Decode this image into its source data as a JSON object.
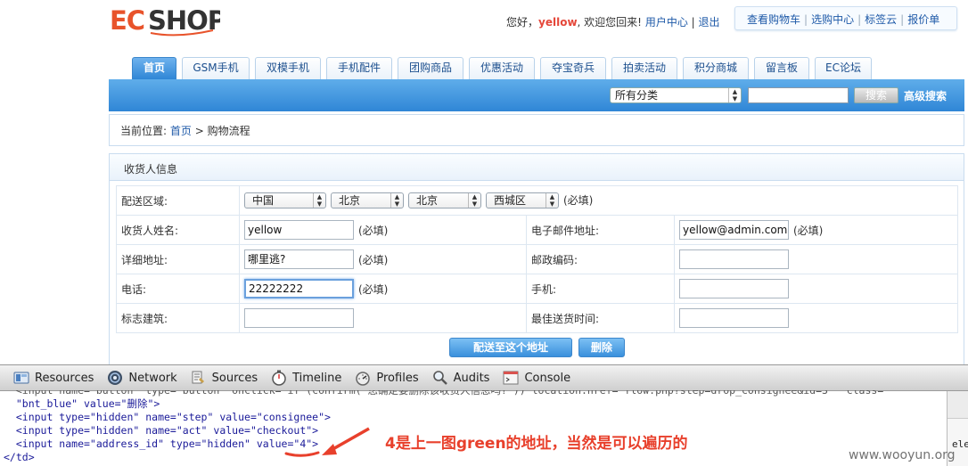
{
  "header": {
    "greeting": "您好，",
    "username": "yellow",
    "welcome": ", 欢迎您回来!",
    "user_center": "用户中心",
    "logout": "退出",
    "sep": "|",
    "top_links": [
      "查看购物车",
      "选购中心",
      "标签云",
      "报价单"
    ]
  },
  "nav": {
    "tabs": [
      "首页",
      "GSM手机",
      "双模手机",
      "手机配件",
      "团购商品",
      "优惠活动",
      "夺宝奇兵",
      "拍卖活动",
      "积分商城",
      "留言板",
      "EC论坛"
    ],
    "active_index": 0
  },
  "search": {
    "category": "所有分类",
    "query": "",
    "button": "搜索",
    "advanced": "高级搜索"
  },
  "breadcrumb": {
    "prefix": "当前位置: ",
    "home": "首页",
    "sep": " > ",
    "current": "购物流程"
  },
  "consignee": {
    "title": "收货人信息",
    "region_label": "配送区域:",
    "regions": [
      "中国",
      "北京",
      "北京",
      "西城区"
    ],
    "required": "(必填)",
    "name_label": "收货人姓名:",
    "name_value": "yellow",
    "email_label": "电子邮件地址:",
    "email_value": "yellow@admin.com",
    "address_label": "详细地址:",
    "address_value": "哪里逃?",
    "zipcode_label": "邮政编码:",
    "zipcode_value": "",
    "phone_label": "电话:",
    "phone_value": "22222222",
    "mobile_label": "手机:",
    "mobile_value": "",
    "landmark_label": "标志建筑:",
    "landmark_value": "",
    "besttime_label": "最佳送货时间:",
    "besttime_value": "",
    "submit_button": "配送至这个地址",
    "delete_button": "删除"
  },
  "devtools": {
    "tabs": [
      "Resources",
      "Network",
      "Sources",
      "Timeline",
      "Profiles",
      "Audits",
      "Console"
    ],
    "code_lines": [
      "  <input name=\"button\" type=\"button\" onclick=\"if (confirm('您确定要删除该收货人信息吗?')) location.href='flow.php?step=drop_consignee&id=3'\" class=",
      "  \"bnt_blue\" value=\"删除\">",
      "  <input type=\"hidden\" name=\"step\" value=\"consignee\">",
      "  <input type=\"hidden\" name=\"act\" value=\"checkout\">",
      "  <input name=\"address_id\" type=\"hidden\" value=\"4\">",
      "</td>"
    ],
    "sidebar_text": "ele"
  },
  "annotation": "4是上一图green的地址，当然是可以遍历的",
  "watermark": "www.wooyun.org",
  "colors": {
    "brand_blue": "#2f86d6",
    "logo_orange": "#e8532b",
    "annotation_red": "#e8402c"
  }
}
